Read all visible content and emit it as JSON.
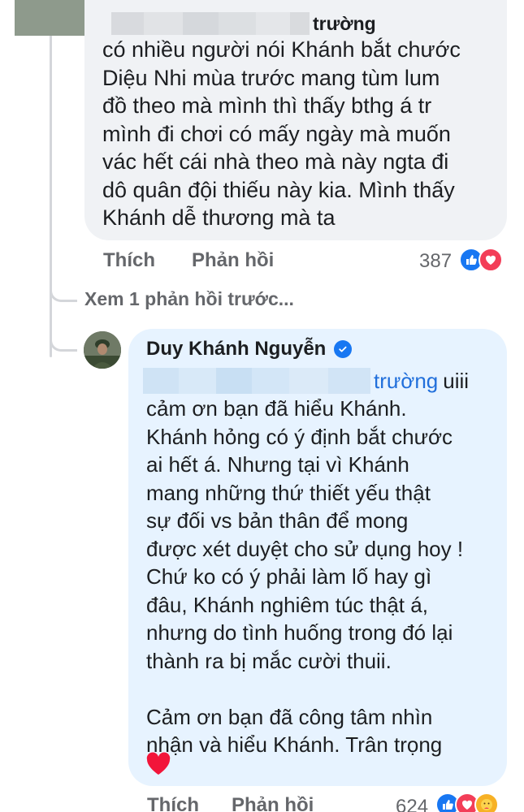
{
  "first_comment": {
    "author_suffix": "trường",
    "lines": [
      "có nhiều người nói Khánh bắt chước",
      "Diệu Nhi mùa trước mang tùm lum",
      "đồ theo mà mình thì thấy bthg á tr",
      "mình đi chơi có mấy ngày mà muốn",
      "vác hết cái nhà theo mà này ngta đi",
      "dô quân đội thiếu này kia. Mình thấy",
      "Khánh dễ thương mà ta"
    ],
    "actions": {
      "like": "Thích",
      "reply": "Phản hồi"
    },
    "reaction_count": "387",
    "reactions": [
      "like-icon",
      "love-icon"
    ]
  },
  "view_previous": "Xem 1 phản hồi trước...",
  "reply": {
    "author": "Duy Khánh Nguyễn",
    "verified": true,
    "mention": "trường",
    "mention_rest": "uiii",
    "body": "cảm ơn bạn đã hiểu Khánh.\nKhánh hỏng có ý định bắt chước\nai hết á. Nhưng tại vì Khánh\nmang những thứ thiết yếu thật\nsự đối vs bản thân để mong\nđược xét duyệt cho sử dụng hoy !\nChứ ko có ý phải làm lố hay gì\nđâu, Khánh nghiêm túc thật á,\nnhưng do tình huống trong đó lại\nthành ra bị mắc cười thuii.\n\nCảm ơn bạn đã công tâm nhìn\nnhận và hiểu Khánh. Trân trọng",
    "emoji": "heart-emoji",
    "actions": {
      "like": "Thích",
      "reply": "Phản hồi"
    },
    "reaction_count": "624",
    "reactions": [
      "like-icon",
      "love-icon",
      "care-icon"
    ]
  },
  "colors": {
    "comment_bubble": "#f0f2f5",
    "reply_bubble": "#e7f3ff",
    "mention": "#216fdb",
    "meta_text": "#65676b",
    "like": "#1877f2",
    "love": "#f33e58"
  }
}
